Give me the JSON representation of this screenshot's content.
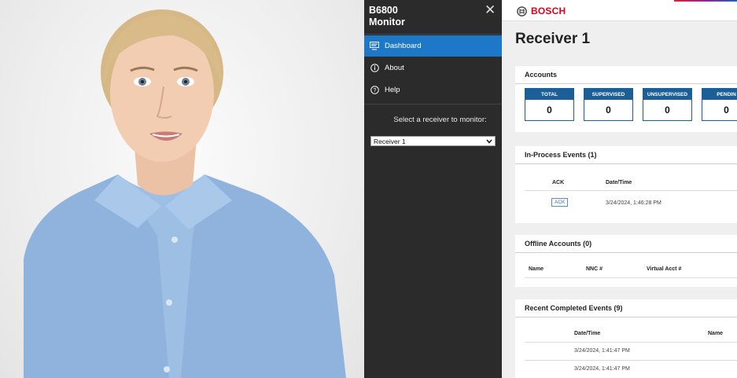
{
  "sidebar": {
    "app_title_line1": "B6800",
    "app_title_line2": "Monitor",
    "close_glyph": "✕",
    "items": [
      {
        "label": "Dashboard",
        "icon": "monitor-icon",
        "active": true
      },
      {
        "label": "About",
        "icon": "info-icon",
        "active": false
      },
      {
        "label": "Help",
        "icon": "help-icon",
        "active": false
      }
    ],
    "receiver_prompt": "Select a receiver to monitor:",
    "receiver_selected": "Receiver 1"
  },
  "header": {
    "brand": "BOSCH"
  },
  "main": {
    "title": "Receiver 1",
    "accounts": {
      "heading": "Accounts",
      "stats": [
        {
          "label": "TOTAL",
          "value": "0"
        },
        {
          "label": "SUPERVISED",
          "value": "0"
        },
        {
          "label": "UNSUPERVISED",
          "value": "0"
        },
        {
          "label": "PENDIN",
          "value": "0"
        }
      ]
    },
    "in_process": {
      "heading": "In-Process Events (1)",
      "columns": [
        "ACK",
        "Date/Time"
      ],
      "rows": [
        {
          "ack": "ACK",
          "datetime": "3/24/2024, 1:46:28 PM"
        }
      ]
    },
    "offline": {
      "heading": "Offline Accounts (0)",
      "columns": [
        "Name",
        "NNC #",
        "Virtual Acct #"
      ]
    },
    "completed": {
      "heading": "Recent Completed Events (9)",
      "columns": [
        "Date/Time",
        "Name"
      ],
      "rows": [
        {
          "datetime": "3/24/2024, 1:41:47 PM"
        },
        {
          "datetime": "3/24/2024, 1:41:47 PM"
        }
      ]
    }
  },
  "colors": {
    "accent": "#1e78c8",
    "brand": "#e2001a",
    "stat_header": "#1b5f98",
    "sidebar_bg": "#2b2b2b"
  }
}
